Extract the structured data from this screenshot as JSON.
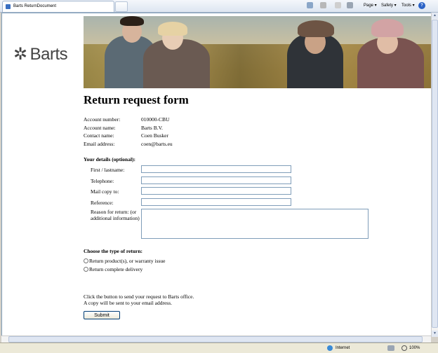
{
  "browser": {
    "tab_title": "Barts ReturnDocument",
    "commands": {
      "page": "Page ▾",
      "safety": "Safety ▾",
      "tools": "Tools ▾",
      "help": "?"
    },
    "status": {
      "zone": "Internet",
      "zoom": "100%"
    }
  },
  "page": {
    "brand": "Barts",
    "title": "Return request form",
    "account": [
      {
        "label": "Account number:",
        "value": "010000-CBU"
      },
      {
        "label": "Account name:",
        "value": "Barts B.V."
      },
      {
        "label": "Contact name:",
        "value": "Coen Busker"
      },
      {
        "label": "Email address:",
        "value": "coen@barts.eu"
      }
    ],
    "details_heading": "Your details (optional):",
    "fields": {
      "name": "First / lastname:",
      "telephone": "Telephone:",
      "mailcopy": "Mail copy to:",
      "reference": "Reference:",
      "reason": "Reason for return: (or additional information)"
    },
    "return_type_heading": "Choose the type of return:",
    "return_options": [
      "Return product(s), or warranty issue",
      "Return complete delivery"
    ],
    "note_line1": "Click the button to send your request to Barts office.",
    "note_line2": "A copy will be sent to your email address.",
    "submit_label": "Submit"
  }
}
